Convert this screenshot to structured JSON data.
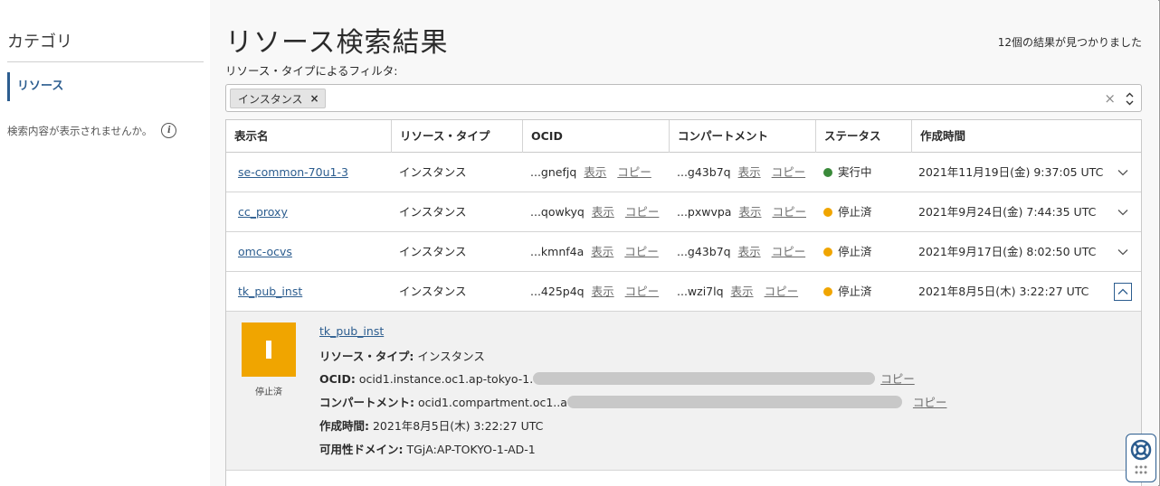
{
  "sidebar": {
    "title": "カテゴリ",
    "items": [
      {
        "label": "リソース"
      }
    ],
    "help_text": "検索内容が表示されませんか。",
    "help_icon": "i"
  },
  "header": {
    "title": "リソース検索結果",
    "result_count": "12個の結果が見つかりました",
    "filter_label": "リソース・タイプによるフィルタ:"
  },
  "filter": {
    "chips": [
      {
        "label": "インスタンス",
        "remove": "×"
      }
    ],
    "clear": "×",
    "toggle_up": "⌃",
    "toggle_down": "⌄"
  },
  "table": {
    "columns": [
      "表示名",
      "リソース・タイプ",
      "OCID",
      "コンパートメント",
      "ステータス",
      "作成時間"
    ],
    "view_label": "表示",
    "copy_label": "コピー",
    "rows": [
      {
        "name": "se-common-70u1-3",
        "type": "インスタンス",
        "ocid": "...gnefjq",
        "compartment": "...g43b7q",
        "status": "実行中",
        "status_color": "#3a8a3a",
        "created": "2021年11月19日(金) 9:37:05 UTC"
      },
      {
        "name": "cc_proxy",
        "type": "インスタンス",
        "ocid": "...qowkyq",
        "compartment": "...pxwvpa",
        "status": "停止済",
        "status_color": "#f0a500",
        "created": "2021年9月24日(金) 7:44:35 UTC"
      },
      {
        "name": "omc-ocvs",
        "type": "インスタンス",
        "ocid": "...kmnf4a",
        "compartment": "...g43b7q",
        "status": "停止済",
        "status_color": "#f0a500",
        "created": "2021年9月17日(金) 8:02:50 UTC"
      },
      {
        "name": "tk_pub_inst",
        "type": "インスタンス",
        "ocid": "...425p4q",
        "compartment": "...wzi7lq",
        "status": "停止済",
        "status_color": "#f0a500",
        "created": "2021年8月5日(木) 3:22:27 UTC"
      }
    ]
  },
  "detail": {
    "name": "tk_pub_inst",
    "state_label": "停止済",
    "state_color": "#f0a500",
    "type_label": "リソース・タイプ:",
    "type_value": "インスタンス",
    "ocid_label": "OCID:",
    "ocid_value": "ocid1.instance.oc1.ap-tokyo-1.",
    "compartment_label": "コンパートメント:",
    "compartment_value": "ocid1.compartment.oc1..a",
    "created_label": "作成時間:",
    "created_value": "2021年8月5日(木) 3:22:27 UTC",
    "ad_label": "可用性ドメイン:",
    "ad_value": "TGjA:AP-TOKYO-1-AD-1",
    "copy_label": "コピー"
  },
  "colors": {
    "accent": "#2c5d8f",
    "running": "#3a8a3a",
    "stopped": "#f0a500"
  }
}
